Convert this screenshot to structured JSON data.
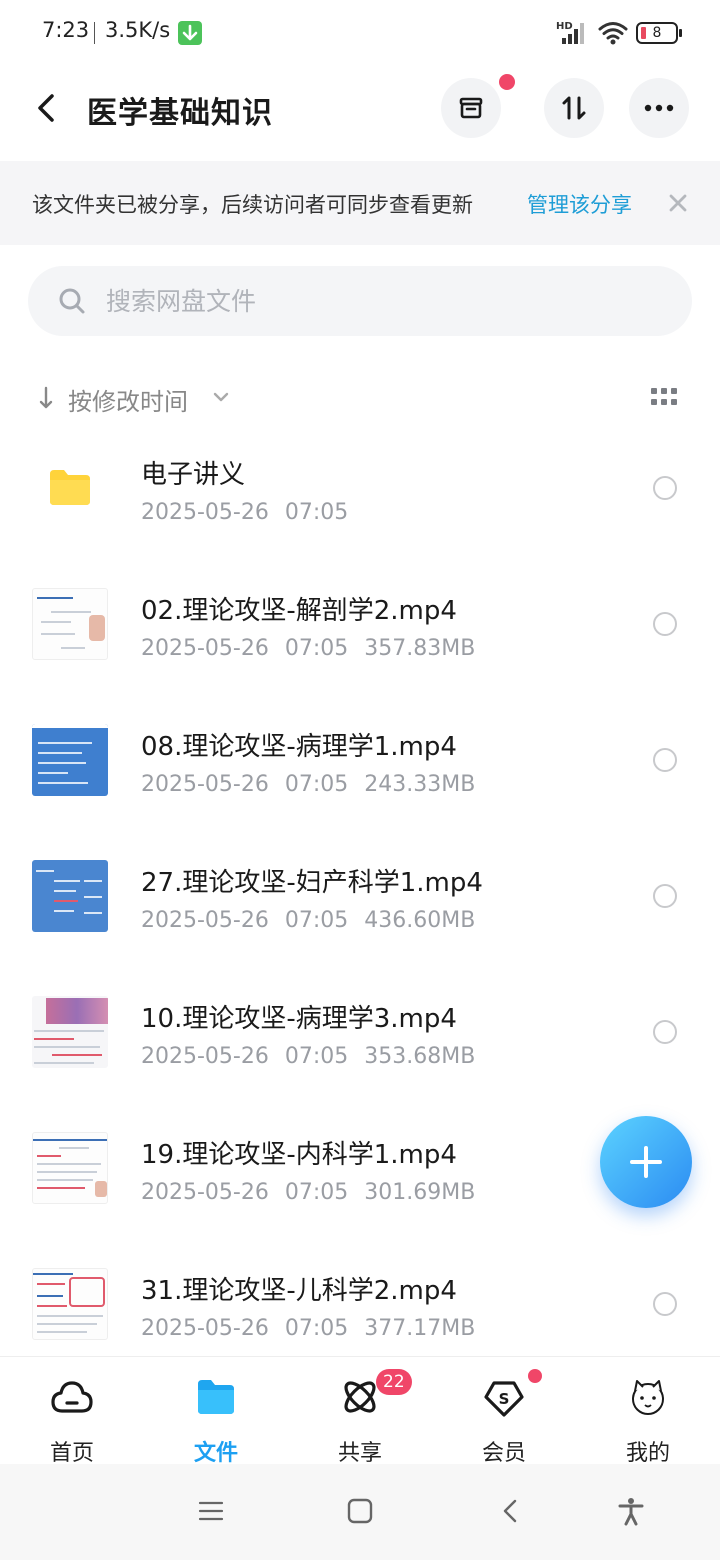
{
  "status_bar": {
    "time": "7:23",
    "speed": "3.5K/s",
    "network": "HD",
    "battery": "8"
  },
  "header": {
    "title": "医学基础知识"
  },
  "share_banner": {
    "text": "该文件夹已被分享，后续访问者可同步查看更新",
    "link": "管理该分享"
  },
  "search": {
    "placeholder": "搜索网盘文件"
  },
  "sort": {
    "label": "按修改时间"
  },
  "files": [
    {
      "name": "电子讲义",
      "date": "2025-05-26",
      "time": "07:05",
      "size": ""
    },
    {
      "name": "02.理论攻坚-解剖学2.mp4",
      "date": "2025-05-26",
      "time": "07:05",
      "size": "357.83MB"
    },
    {
      "name": "08.理论攻坚-病理学1.mp4",
      "date": "2025-05-26",
      "time": "07:05",
      "size": "243.33MB"
    },
    {
      "name": "27.理论攻坚-妇产科学1.mp4",
      "date": "2025-05-26",
      "time": "07:05",
      "size": "436.60MB"
    },
    {
      "name": "10.理论攻坚-病理学3.mp4",
      "date": "2025-05-26",
      "time": "07:05",
      "size": "353.68MB"
    },
    {
      "name": "19.理论攻坚-内科学1.mp4",
      "date": "2025-05-26",
      "time": "07:05",
      "size": "301.69MB"
    },
    {
      "name": "31.理论攻坚-儿科学2.mp4",
      "date": "2025-05-26",
      "time": "07:05",
      "size": "377.17MB"
    }
  ],
  "bottom_nav": {
    "home": "首页",
    "files": "文件",
    "share": "共享",
    "share_badge": "22",
    "vip": "会员",
    "mine": "我的"
  },
  "colors": {
    "accent": "#1da0f2",
    "badge": "#f04668",
    "link": "#1e9dd6"
  }
}
